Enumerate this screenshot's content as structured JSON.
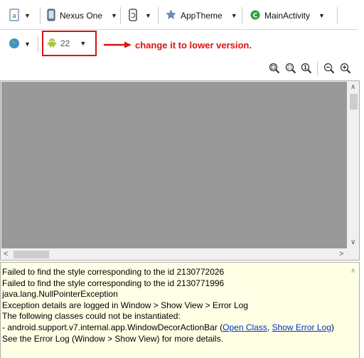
{
  "toolbar": {
    "device_label": "Nexus One",
    "theme_label": "AppTheme",
    "activity_label": "MainActivity",
    "api_level": "22"
  },
  "annotation": {
    "text": "change it to lower version."
  },
  "console": {
    "lines": [
      "Failed to find the style corresponding to the id 2130772026",
      "Failed to find the style corresponding to the id 2130771996",
      "java.lang.NullPointerException",
      "Exception details are logged in Window > Show View > Error Log",
      "The following classes could not be instantiated:"
    ],
    "class_line_prefix": "- android.support.v7.internal.app.WindowDecorActionBar (",
    "open_class_link": "Open Class",
    "link_separator": ", ",
    "show_error_log_link": "Show Error Log",
    "class_line_suffix": ")",
    "last_line": "See the Error Log (Window > Show View) for more details."
  },
  "colors": {
    "annotation_red": "#e01010",
    "android_green": "#a4c639",
    "console_bg": "#ffffe5",
    "canvas_gray": "#999999",
    "link_blue": "#0033cc"
  },
  "icons": [
    "config-file-icon",
    "device-icon",
    "orientation-icon",
    "theme-star-icon",
    "activity-icon",
    "globe-icon",
    "android-icon",
    "zoom-fit-icon",
    "zoom-actual-icon",
    "zoom-100-icon",
    "zoom-out-icon",
    "zoom-in-icon"
  ]
}
